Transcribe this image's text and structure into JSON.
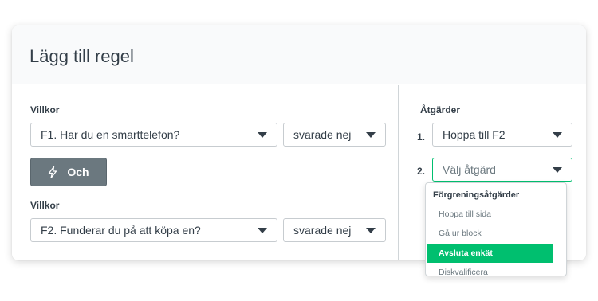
{
  "card": {
    "title": "Lägg till regel"
  },
  "left": {
    "condition1": {
      "label": "Villkor",
      "question": "F1. Har du en smarttelefon?",
      "answer": "svarade nej"
    },
    "and_button": "Och",
    "condition2": {
      "label": "Villkor",
      "question": "F2. Funderar du på att köpa en?",
      "answer": "svarade nej"
    }
  },
  "right": {
    "label": "Åtgärder",
    "actions": [
      {
        "number": "1.",
        "value": "Hoppa till F2"
      },
      {
        "number": "2.",
        "placeholder": "Välj åtgärd"
      }
    ]
  },
  "dropdown": {
    "header": "Förgreningsåtgärder",
    "items": [
      {
        "label": "Hoppa till sida",
        "selected": false
      },
      {
        "label": "Gå ur block",
        "selected": false
      },
      {
        "label": "Avsluta enkät",
        "selected": true
      },
      {
        "label": "Diskvalificera",
        "selected": false
      }
    ]
  },
  "colors": {
    "accent": "#00bf6f",
    "button": "#6b787f",
    "text": "#333e48"
  }
}
